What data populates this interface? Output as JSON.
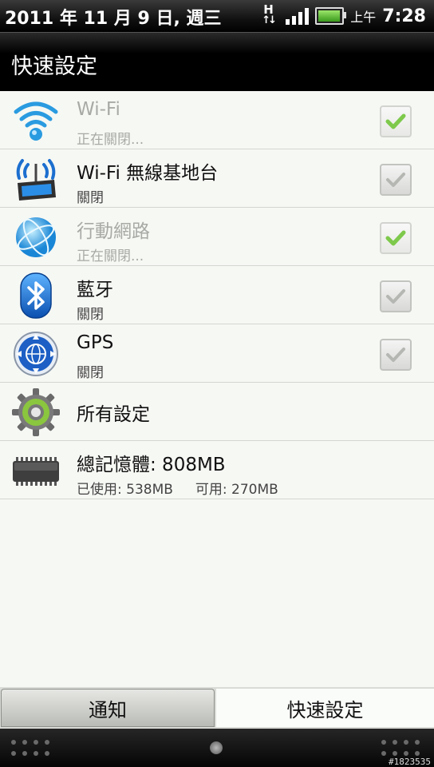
{
  "status": {
    "date": "2011 年 11 月 9 日, 週三",
    "network": "H",
    "ampm": "上午",
    "time": "7:28",
    "battery_level": 0.95,
    "signal_bars": 4
  },
  "header": {
    "title": "快速設定"
  },
  "rows": [
    {
      "title": "Wi-Fi",
      "subtitle": "正在關閉...",
      "icon": "wifi-icon",
      "checked": true,
      "enabled": false
    },
    {
      "title": "Wi-Fi 無線基地台",
      "subtitle": "關閉",
      "icon": "wifi-hotspot-icon",
      "checked": false,
      "enabled": true
    },
    {
      "title": "行動網路",
      "subtitle": "正在關閉...",
      "icon": "mobile-network-globe-icon",
      "checked": true,
      "enabled": false
    },
    {
      "title": "藍牙",
      "subtitle": "關閉",
      "icon": "bluetooth-icon",
      "checked": false,
      "enabled": true
    },
    {
      "title": "GPS",
      "subtitle": "關閉",
      "icon": "gps-icon",
      "checked": false,
      "enabled": true
    },
    {
      "title": "所有設定",
      "icon": "settings-gear-icon"
    },
    {
      "title": "總記憶體: 808MB",
      "used": "已使用: 538MB",
      "available": "可用: 270MB",
      "icon": "memory-chip-icon"
    }
  ],
  "tabs": {
    "notifications": "通知",
    "quick_settings": "快速設定",
    "active": "quick_settings"
  },
  "watermark": "#1823535",
  "colors": {
    "check_enabled": "#7ec94c",
    "check_disabled": "#b5b7b3",
    "panel_bg": "#f6f8f4"
  }
}
